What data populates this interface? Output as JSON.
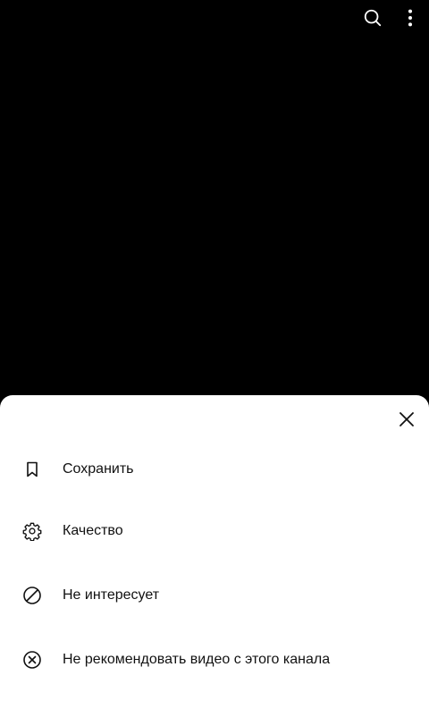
{
  "player": {
    "background": "#000000",
    "top_actions": [
      {
        "icon": "search-icon",
        "color": "#ffffff"
      },
      {
        "icon": "more-vertical-icon",
        "color": "#ffffff"
      }
    ]
  },
  "sheet": {
    "background": "#ffffff",
    "close_icon": "close-icon",
    "items": [
      {
        "icon": "bookmark-icon",
        "label": "Сохранить"
      },
      {
        "icon": "gear-icon",
        "label": "Качество"
      },
      {
        "icon": "block-icon",
        "label": "Не интересует"
      },
      {
        "icon": "circle-x-icon",
        "label": "Не рекомендовать видео с этого канала"
      }
    ]
  }
}
